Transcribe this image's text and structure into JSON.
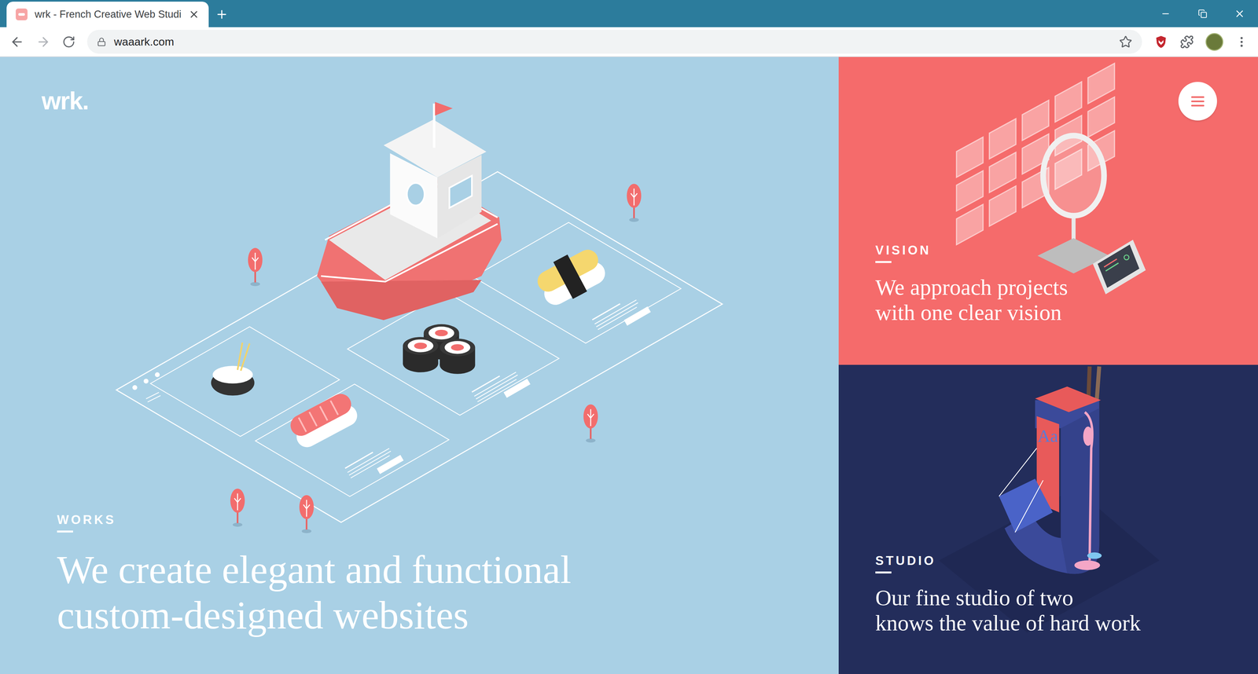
{
  "browser": {
    "tabs": [
      {
        "title": "wrk - French Creative Web Studi",
        "selected": true
      }
    ],
    "address_bar": {
      "url": "waaark.com"
    }
  },
  "page": {
    "logo": "wrk.",
    "sections": [
      {
        "label": "WORKS",
        "heading_lines": [
          "We create elegant and functional",
          "custom-designed websites"
        ],
        "color": "#a9d0e5"
      },
      {
        "label": "VISION",
        "heading_lines": [
          "We approach projects",
          "with one clear vision"
        ],
        "color": "#f56b6b"
      },
      {
        "label": "STUDIO",
        "heading_lines": [
          "Our fine studio of two",
          "knows the value of hard work"
        ],
        "color": "#232d5b",
        "figure_text": "Aa"
      }
    ]
  }
}
